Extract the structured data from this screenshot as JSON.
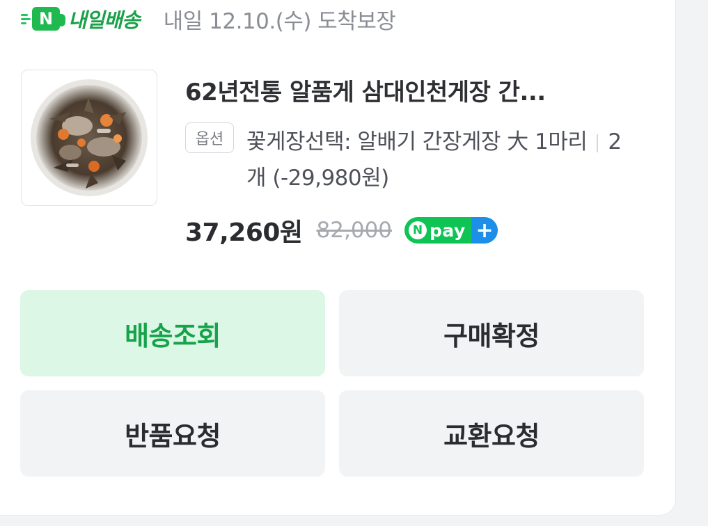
{
  "delivery": {
    "badge_label": "내일배송",
    "badge_icon": "N",
    "date_text": "내일 12.10.(수) 도착보장",
    "accent_color": "#1fb94f"
  },
  "product": {
    "image_icon": "marinated-crab-photo",
    "title": "62년전통 알품게 삼대인천게장 간...",
    "option_tag": "옵션",
    "option_text": "꽃게장선택: 알배기 간장게장 大 1마리",
    "quantity_text": "2개 (-29,980원)",
    "price": "37,260원",
    "original_price": "82,000",
    "npay": {
      "n_letter": "N",
      "label": "pay",
      "plus": "+"
    }
  },
  "actions": {
    "track_delivery": "배송조회",
    "confirm_purchase": "구매확정",
    "return_request": "반품요청",
    "exchange_request": "교환요청"
  }
}
